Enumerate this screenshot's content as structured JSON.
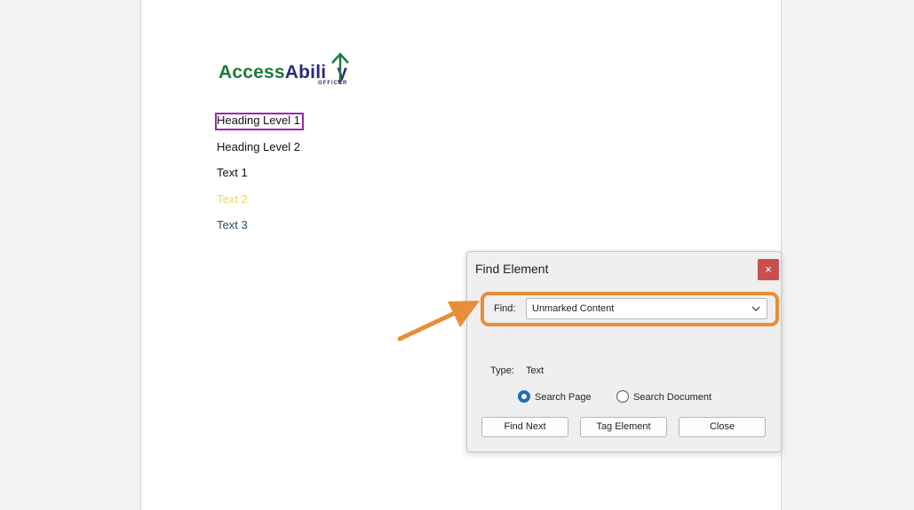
{
  "logo": {
    "part_a": "Access",
    "part_b": "Abili",
    "part_c": "y",
    "subtext": "OFFICER",
    "colors": {
      "green": "#1d7a3a",
      "navy": "#2e2a7a"
    }
  },
  "document": {
    "lines": [
      {
        "text": "Heading Level 1",
        "color": "#111111"
      },
      {
        "text": "Heading Level 2",
        "color": "#111111"
      },
      {
        "text": "Text 1",
        "color": "#111111"
      },
      {
        "text": "Text 2",
        "color": "#f5d35a"
      },
      {
        "text": "Text 3",
        "color": "#1f4e79"
      }
    ],
    "highlight_color": "#9b27b0"
  },
  "dialog": {
    "title": "Find Element",
    "close_glyph": "×",
    "find_label": "Find:",
    "find_value": "Unmarked Content",
    "dropdown_glyph": "⌵",
    "type_label": "Type:",
    "type_value": "Text",
    "radios": [
      {
        "label": "Search Page",
        "checked": true
      },
      {
        "label": "Search Document",
        "checked": false
      }
    ],
    "buttons": {
      "find_next": "Find Next",
      "tag_element": "Tag Element",
      "close": "Close"
    }
  },
  "annotation": {
    "color": "#e88e38",
    "icon": "arrow-icon"
  }
}
